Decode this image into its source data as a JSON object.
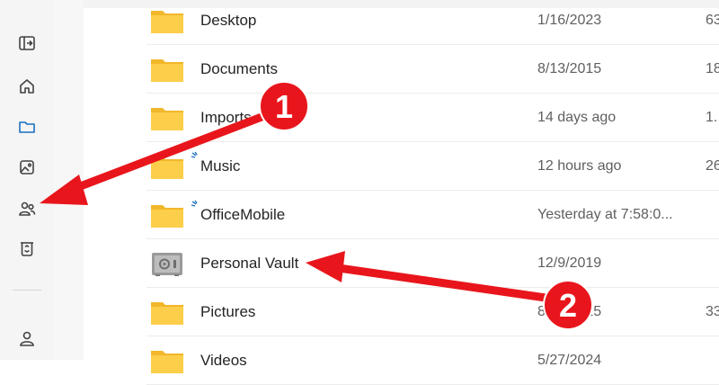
{
  "sidebar": {
    "items": [
      {
        "icon": "collapse-pane-icon"
      },
      {
        "icon": "home-icon"
      },
      {
        "icon": "folder-icon"
      },
      {
        "icon": "photos-icon"
      },
      {
        "icon": "shared-people-icon"
      },
      {
        "icon": "recycle-bin-icon"
      },
      {
        "icon": "account-icon"
      }
    ],
    "active_item": "folder-icon",
    "accent_color": "#1b6fc1"
  },
  "files": [
    {
      "name": "Desktop",
      "modified": "1/16/2023",
      "size": "63",
      "icon": "folder-icon",
      "sync": false
    },
    {
      "name": "Documents",
      "modified": "8/13/2015",
      "size": "18",
      "icon": "folder-icon",
      "sync": false
    },
    {
      "name": "Imports",
      "modified": "14 days ago",
      "size": "1.",
      "icon": "folder-icon",
      "sync": false
    },
    {
      "name": "Music",
      "modified": "12 hours ago",
      "size": "26",
      "icon": "folder-icon",
      "sync": true
    },
    {
      "name": "OfficeMobile",
      "modified": "Yesterday at 7:58:0...",
      "size": "",
      "icon": "folder-icon",
      "sync": true
    },
    {
      "name": "Personal Vault",
      "modified": "12/9/2019",
      "size": "",
      "icon": "vault-icon",
      "sync": false
    },
    {
      "name": "Pictures",
      "modified": "8/13/2015",
      "size": "33",
      "icon": "folder-icon",
      "sync": false
    },
    {
      "name": "Videos",
      "modified": "5/27/2024",
      "size": "",
      "icon": "folder-icon",
      "sync": false
    }
  ],
  "annotations": {
    "arrow_color": "#e8161c",
    "badges": [
      {
        "label": "1"
      },
      {
        "label": "2"
      }
    ]
  }
}
